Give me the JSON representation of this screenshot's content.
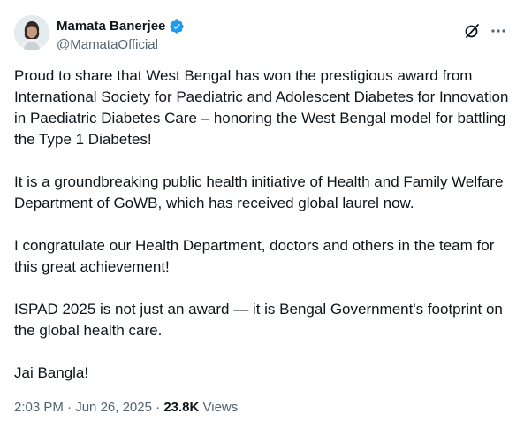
{
  "author": {
    "display_name": "Mamata Banerjee",
    "handle": "@MamataOfficial",
    "avatar_icon": "profile-photo",
    "verified_icon": "verified-badge-icon",
    "verified_color": "#1d9bf0"
  },
  "header_actions": {
    "grok_icon": "grok-icon",
    "more_icon": "more-options-icon"
  },
  "post": {
    "paragraphs": [
      "Proud to share that West Bengal has won the prestigious award from International Society for Paediatric and Adolescent Diabetes for Innovation in Paediatric Diabetes Care – honoring the West Bengal model for battling the Type 1 Diabetes!",
      "It is a groundbreaking public health initiative of Health and Family Welfare Department of GoWB, which has received global laurel now.",
      "I congratulate our Health Department, doctors and others in the team for this great achievement!",
      "ISPAD 2025 is not just an award — it is Bengal Government's footprint on the global health care.",
      "Jai Bangla!"
    ]
  },
  "meta": {
    "time": "2:03 PM",
    "separator": "·",
    "date": "Jun 26, 2025",
    "views_count": "23.8K",
    "views_label": "Views"
  },
  "colors": {
    "text_primary": "#0f1419",
    "text_secondary": "#536471",
    "background": "#ffffff"
  }
}
